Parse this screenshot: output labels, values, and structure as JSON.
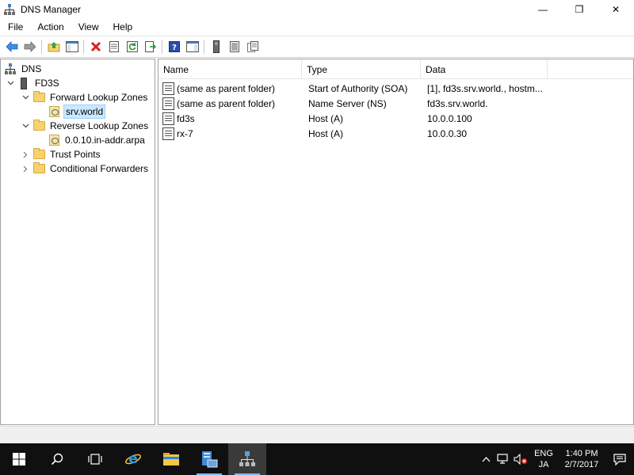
{
  "window": {
    "title": "DNS Manager",
    "minimize": "—",
    "maximize": "❐",
    "close": "✕"
  },
  "menu": [
    "File",
    "Action",
    "View",
    "Help"
  ],
  "tree": {
    "root": "DNS",
    "server": "FD3S",
    "forward_zones": "Forward Lookup Zones",
    "forward_zone_item": "srv.world",
    "reverse_zones": "Reverse Lookup Zones",
    "reverse_zone_item": "0.0.10.in-addr.arpa",
    "trust_points": "Trust Points",
    "conditional_forwarders": "Conditional Forwarders"
  },
  "list": {
    "columns": [
      "Name",
      "Type",
      "Data"
    ],
    "rows": [
      {
        "name": "(same as parent folder)",
        "type": "Start of Authority (SOA)",
        "data": "[1], fd3s.srv.world., hostm..."
      },
      {
        "name": "(same as parent folder)",
        "type": "Name Server (NS)",
        "data": "fd3s.srv.world."
      },
      {
        "name": "fd3s",
        "type": "Host (A)",
        "data": "10.0.0.100"
      },
      {
        "name": "rx-7",
        "type": "Host (A)",
        "data": "10.0.0.30"
      }
    ]
  },
  "taskbar": {
    "lang_top": "ENG",
    "lang_bottom": "JA",
    "time": "1:40 PM",
    "date": "2/7/2017"
  },
  "colors": {
    "taskbar": "#101010",
    "selection": "#cce8ff",
    "accent": "#76b9ed"
  }
}
